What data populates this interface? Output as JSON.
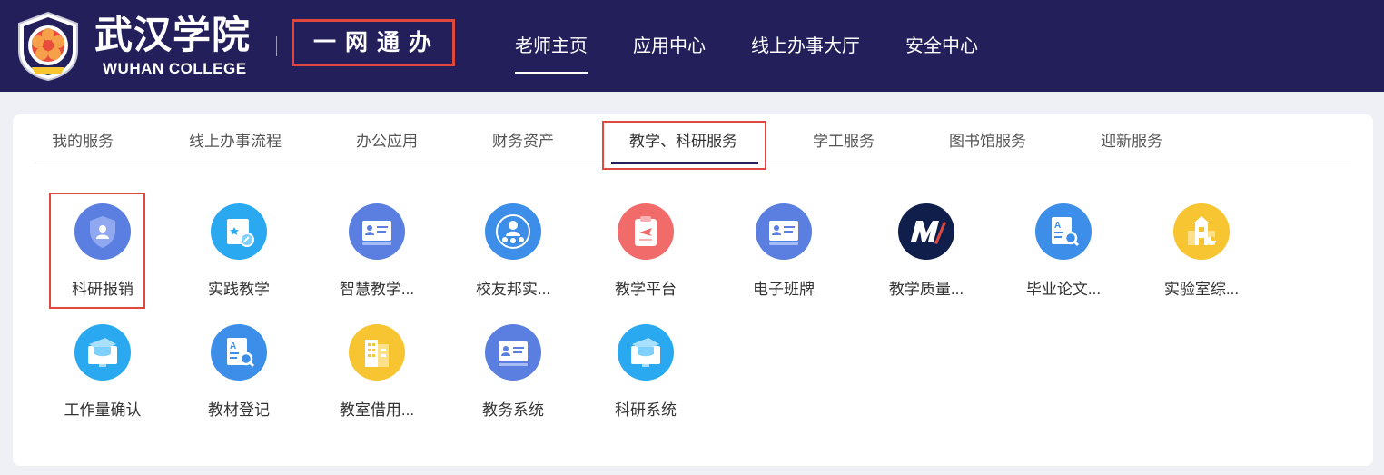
{
  "header": {
    "logo_cn": "武汉学院",
    "logo_en": "WUHAN COLLEGE",
    "portal_title": "一网通办",
    "nav": [
      {
        "label": "老师主页"
      },
      {
        "label": "应用中心"
      },
      {
        "label": "线上办事大厅"
      },
      {
        "label": "安全中心"
      }
    ],
    "active_nav": "老师主页"
  },
  "tabs": [
    {
      "label": "我的服务"
    },
    {
      "label": "线上办事流程"
    },
    {
      "label": "办公应用"
    },
    {
      "label": "财务资产"
    },
    {
      "label": "教学、科研服务"
    },
    {
      "label": "学工服务"
    },
    {
      "label": "图书馆服务"
    },
    {
      "label": "迎新服务"
    }
  ],
  "active_tab": "教学、科研服务",
  "apps": [
    {
      "label": "科研报销",
      "icon": "shield-user-icon",
      "color": "#5b7fe0"
    },
    {
      "label": "实践教学",
      "icon": "certificate-icon",
      "color": "#2aa8f0"
    },
    {
      "label": "智慧教学...",
      "icon": "id-card-icon",
      "color": "#5b7fe0"
    },
    {
      "label": "校友邦实...",
      "icon": "alumni-icon",
      "color": "#3d8ee8"
    },
    {
      "label": "教学平台",
      "icon": "clipboard-icon",
      "color": "#f26b6b"
    },
    {
      "label": "电子班牌",
      "icon": "id-card-icon",
      "color": "#5b7fe0"
    },
    {
      "label": "教学质量...",
      "icon": "m-logo-icon",
      "color": "#0f1e4a"
    },
    {
      "label": "毕业论文...",
      "icon": "document-search-icon",
      "color": "#3d8ee8"
    },
    {
      "label": "实验室综...",
      "icon": "school-building-icon",
      "color": "#f7c531"
    },
    {
      "label": "工作量确认",
      "icon": "graduation-monitor-icon",
      "color": "#2aa8f0"
    },
    {
      "label": "教材登记",
      "icon": "document-search-icon",
      "color": "#3d8ee8"
    },
    {
      "label": "教室借用...",
      "icon": "building-icon",
      "color": "#f7c531"
    },
    {
      "label": "教务系统",
      "icon": "id-card-icon",
      "color": "#5b7fe0"
    },
    {
      "label": "科研系统",
      "icon": "graduation-monitor-icon",
      "color": "#2aa8f0"
    }
  ],
  "colors": {
    "header_bg": "#231f5b",
    "highlight": "#e0483d"
  }
}
